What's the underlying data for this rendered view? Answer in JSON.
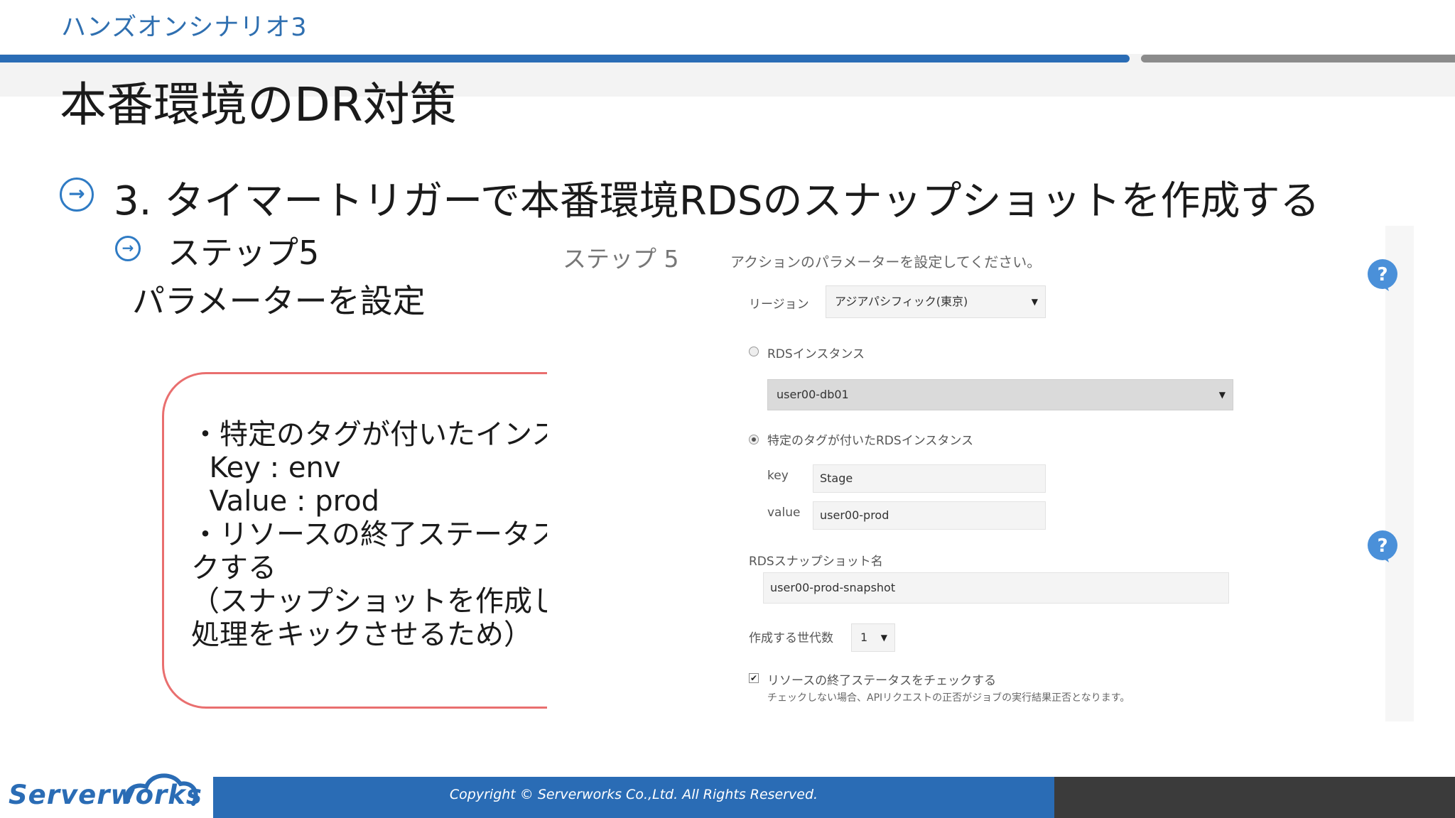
{
  "header": {
    "scenario": "ハンズオンシナリオ3",
    "title": "本番環境のDR対策"
  },
  "content": {
    "main_bullet": "3.  タイマートリガーで本番環境RDSのスナップショットを作成する",
    "sub_step": "ステップ5",
    "sub_desc": "パラメーターを設定"
  },
  "callout": {
    "text": "・特定のタグが付いたインスタンス\n  Key : env\n  Value : prod\n・リソースの終了ステータスをチェッ\nクする\n（スナップショットを作成した後に後\n処理をキックさせるため）"
  },
  "panel": {
    "step_label": "ステップ 5",
    "instruction": "アクションのパラメーターを設定してください。",
    "region_label": "リージョン",
    "region_value": "アジアパシフィック(東京)",
    "rds_instance_label": "RDSインスタンス",
    "rds_instance_value": "user00-db01",
    "tagged_label": "特定のタグが付いたRDSインスタンス",
    "key_label": "key",
    "key_value": "Stage",
    "value_label": "value",
    "value_value": "user00-prod",
    "snapshot_label": "RDSスナップショット名",
    "snapshot_value": "user00-prod-snapshot",
    "generations_label": "作成する世代数",
    "generations_value": "1",
    "check_label": "リソースの終了ステータスをチェックする",
    "check_note": "チェックしない場合、APIリクエストの正否がジョブの実行結果正否となります。",
    "check_checked": true,
    "selected_radio": "tagged"
  },
  "footer": {
    "logo": "Serverworks",
    "copyright": "Copyright ©  Serverworks Co.,Ltd. All Rights Reserved."
  },
  "colors": {
    "brand_blue": "#2a6cb5",
    "callout_border": "#e96f6f",
    "help_icon": "#4a90d9"
  },
  "icons": {
    "bullet": "arrow-right-circle-icon",
    "help": "question-bubble-icon",
    "logo": "cloud-icon"
  }
}
